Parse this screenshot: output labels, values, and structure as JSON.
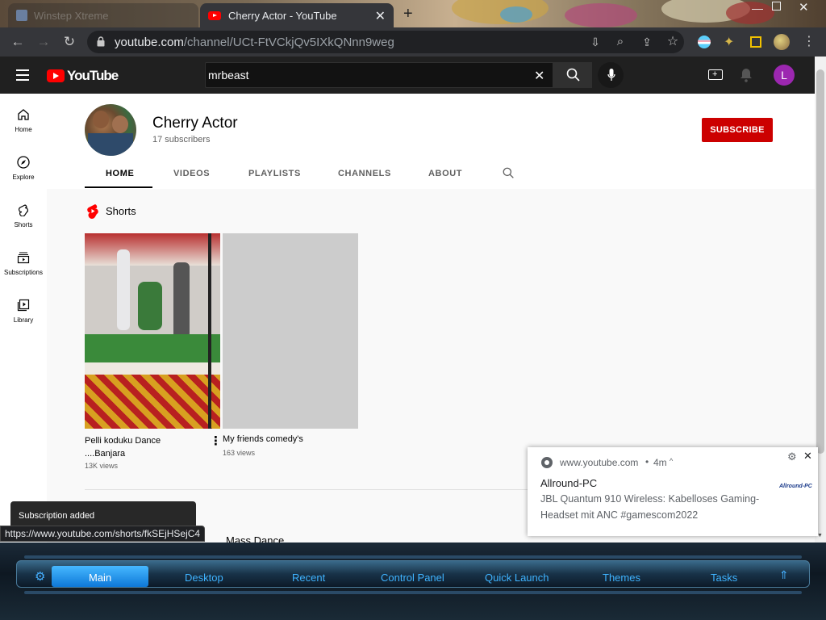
{
  "browser": {
    "tabs": [
      {
        "label": "Winstep Xtreme"
      },
      {
        "label": "Cherry Actor - YouTube"
      }
    ],
    "url": {
      "domain": "youtube.com",
      "path": "/channel/UCt-FtVCkjQv5IXkQNnn9weg"
    }
  },
  "youtube": {
    "logo_text": "YouTube",
    "search_value": "mrbeast",
    "avatar_letter": "L",
    "sidebar": [
      {
        "label": "Home",
        "icon": "home-icon"
      },
      {
        "label": "Explore",
        "icon": "compass-icon"
      },
      {
        "label": "Shorts",
        "icon": "shorts-icon"
      },
      {
        "label": "Subscriptions",
        "icon": "subscriptions-icon"
      },
      {
        "label": "Library",
        "icon": "library-icon"
      }
    ],
    "channel": {
      "name": "Cherry Actor",
      "subscribers": "17 subscribers",
      "subscribe_label": "SUBSCRIBE"
    },
    "tabs": [
      "HOME",
      "VIDEOS",
      "PLAYLISTS",
      "CHANNELS",
      "ABOUT"
    ],
    "active_tab": "HOME",
    "shorts_heading": "Shorts",
    "shorts": [
      {
        "title_line1": "Pelli koduku Dance",
        "title_line2": "....Banjara",
        "views": "13K views"
      },
      {
        "title_line1": "My friends comedy's",
        "title_line2": "",
        "views": "163 views"
      }
    ],
    "next_section": "Mass Dance",
    "toast": "Subscription added",
    "link_hint": "https://www.youtube.com/shorts/fkSEjHSejC4"
  },
  "notification": {
    "source": "www.youtube.com",
    "time": "4m",
    "title": "Allround-PC",
    "body_line1": "JBL Quantum 910 Wireless: Kabelloses Gaming-",
    "body_line2": "Headset mit ANC #gamescom2022",
    "logo_text": "Allround-PC"
  },
  "taskbar": {
    "items": [
      "Main",
      "Desktop",
      "Recent",
      "Control Panel",
      "Quick Launch",
      "Themes",
      "Tasks"
    ],
    "active": "Main"
  },
  "colors": {
    "subscribe_red": "#cc0000",
    "avatar_purple": "#9c27b0",
    "taskbar_text": "#3fb3ff"
  }
}
